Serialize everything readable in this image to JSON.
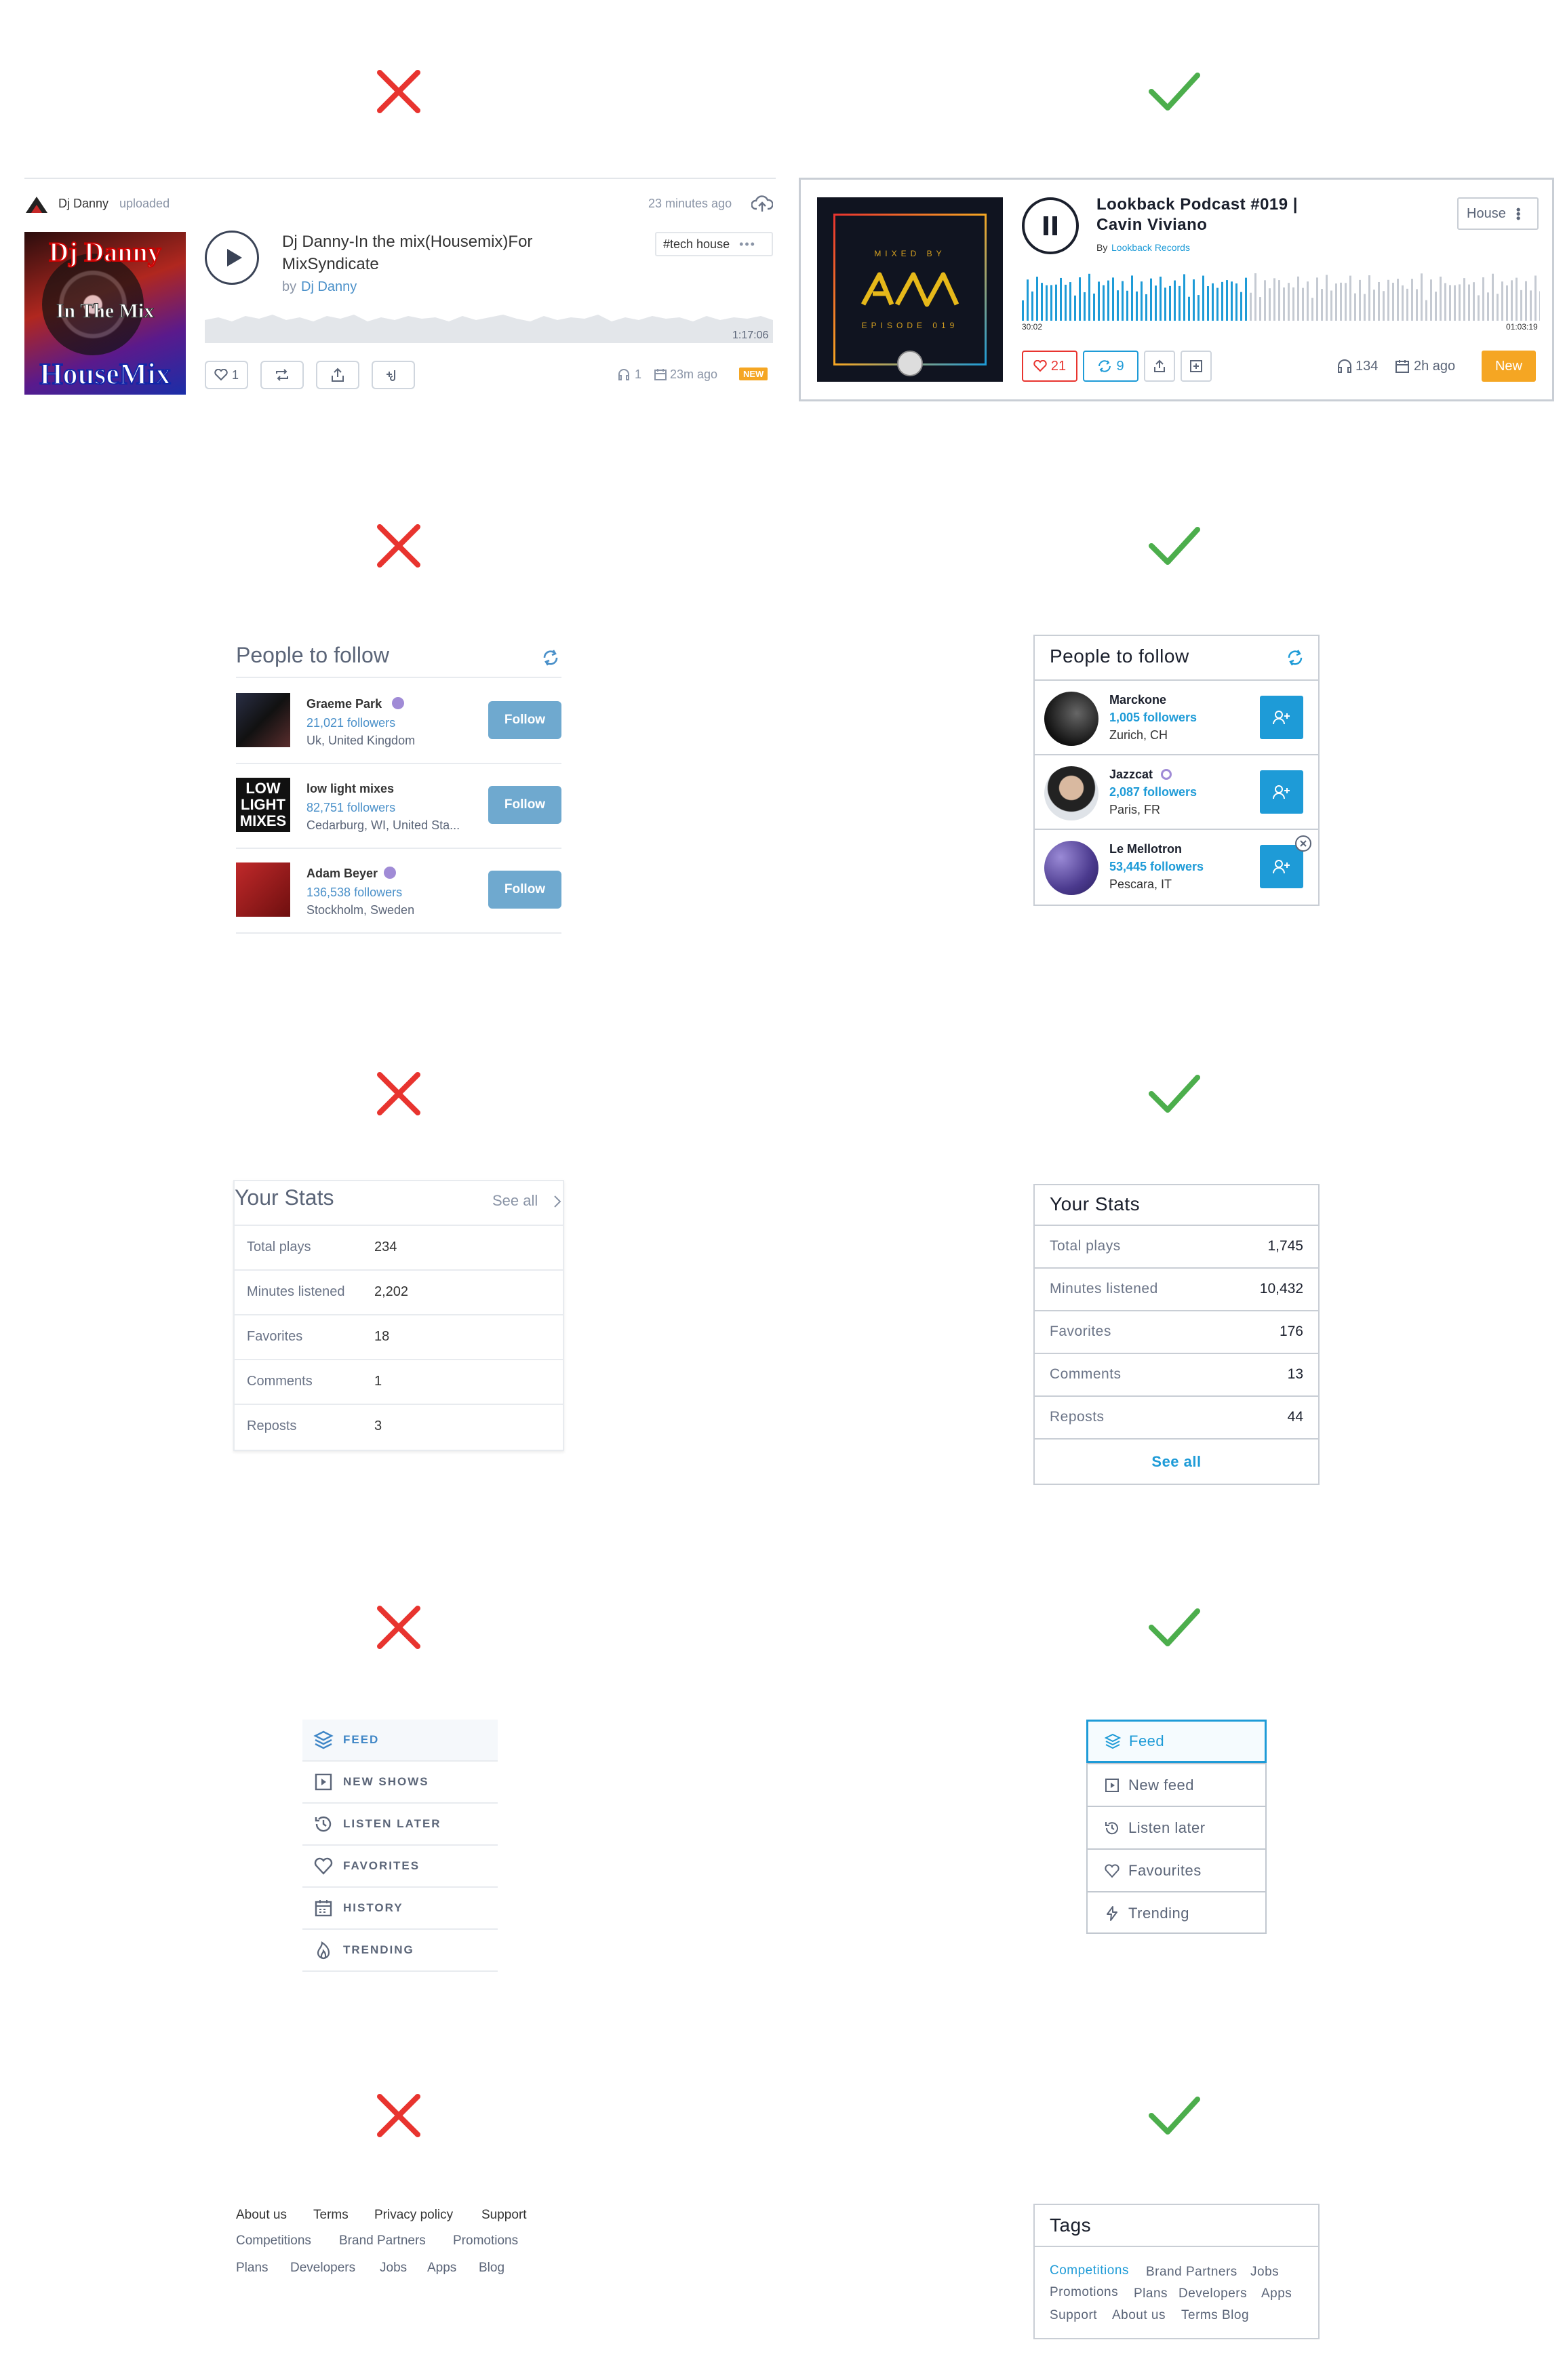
{
  "colors": {
    "bad": "#e8342f",
    "good": "#4cae4c",
    "accent": "#1e9bd7",
    "orange": "#f5a623"
  },
  "bad_player": {
    "uploader": "Dj Danny",
    "uploaded_label": "uploaded",
    "time_ago": "23 minutes ago",
    "title": "Dj Danny-In the mix(Housemix)For MixSyndicate",
    "by_label": "by",
    "artist": "Dj Danny",
    "tag": "#tech house",
    "duration": "1:17:06",
    "like_count": "1",
    "plays": "1",
    "posted": "23m ago",
    "new_badge": "NEW",
    "artwork": {
      "line1": "Dj Danny",
      "line2": "In The Mix",
      "line3": "HouseMix"
    }
  },
  "good_player": {
    "title": "Lookback Podcast #019 | Cavin Viviano",
    "by_label": "By",
    "label": "Lookback Records",
    "genre": "House",
    "time_start": "30:02",
    "time_end": "01:03:19",
    "likes": "21",
    "reposts": "9",
    "plays": "134",
    "posted": "2h ago",
    "new_label": "New",
    "artwork": {
      "mixed_by": "MIXED BY",
      "episode": "EPISODE 019"
    }
  },
  "bad_follow": {
    "title": "People to follow",
    "button_label": "Follow",
    "people": [
      {
        "name": "Graeme Park",
        "followers": "21,021 followers",
        "location": "Uk, United Kingdom"
      },
      {
        "name": "low light mixes",
        "followers": "82,751 followers",
        "location": "Cedarburg, WI, United Sta..."
      },
      {
        "name": "Adam Beyer",
        "followers": "136,538 followers",
        "location": "Stockholm, Sweden"
      }
    ]
  },
  "good_follow": {
    "title": "People to follow",
    "people": [
      {
        "name": "Marckone",
        "followers": "1,005 followers",
        "location": "Zurich, CH"
      },
      {
        "name": "Jazzcat",
        "followers": "2,087 followers",
        "location": "Paris, FR"
      },
      {
        "name": "Le Mellotron",
        "followers": "53,445 followers",
        "location": "Pescara, IT"
      }
    ]
  },
  "bad_stats": {
    "title": "Your Stats",
    "see_all": "See all",
    "rows": [
      {
        "label": "Total plays",
        "value": "234"
      },
      {
        "label": "Minutes listened",
        "value": "2,202"
      },
      {
        "label": "Favorites",
        "value": "18"
      },
      {
        "label": "Comments",
        "value": "1"
      },
      {
        "label": "Reposts",
        "value": "3"
      }
    ]
  },
  "good_stats": {
    "title": "Your Stats",
    "see_all": "See all",
    "rows": [
      {
        "label": "Total plays",
        "value": "1,745"
      },
      {
        "label": "Minutes listened",
        "value": "10,432"
      },
      {
        "label": "Favorites",
        "value": "176"
      },
      {
        "label": "Comments",
        "value": "13"
      },
      {
        "label": "Reposts",
        "value": "44"
      }
    ]
  },
  "bad_nav": [
    "FEED",
    "NEW SHOWS",
    "LISTEN LATER",
    "FAVORITES",
    "HISTORY",
    "TRENDING"
  ],
  "good_nav": [
    "Feed",
    "New feed",
    "Listen later",
    "Favourites",
    "Trending"
  ],
  "bad_footer": {
    "row1": [
      "About us",
      "Terms",
      "Privacy policy",
      "Support"
    ],
    "row2": [
      "Competitions",
      "Brand Partners",
      "Promotions"
    ],
    "row3": [
      "Plans",
      "Developers",
      "Jobs",
      "Apps",
      "Blog"
    ]
  },
  "good_tags": {
    "title": "Tags",
    "row1": [
      "Competitions",
      "Brand Partners",
      "Jobs"
    ],
    "row2": [
      "Promotions",
      "Plans",
      "Developers",
      "Apps"
    ],
    "row3": [
      "Support",
      "About us",
      "Terms",
      "Blog"
    ]
  }
}
